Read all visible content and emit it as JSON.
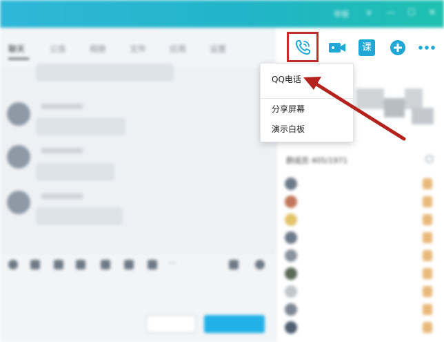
{
  "window": {
    "title": "",
    "report_label": "举报",
    "controls": {
      "dropdown": "∨",
      "minimize": "—",
      "maximize": "☐",
      "close": "✕"
    }
  },
  "tabs": [
    {
      "label": "聊天"
    },
    {
      "label": "公告"
    },
    {
      "label": "相册"
    },
    {
      "label": "文件"
    },
    {
      "label": "应用"
    },
    {
      "label": "设置"
    }
  ],
  "toolbar": {
    "icons": [
      "phone-icon",
      "video-icon",
      "course-icon",
      "add-icon",
      "more-icon"
    ],
    "course_label": "课"
  },
  "dropdown_menu": {
    "items": [
      {
        "label": "QQ电话"
      },
      {
        "label": "分享屏幕"
      },
      {
        "label": "演示白板"
      }
    ]
  },
  "chat": {
    "messages": [
      {
        "text": ""
      },
      {
        "text": ""
      },
      {
        "text": ""
      },
      {
        "text": ""
      }
    ]
  },
  "input": {
    "close_label": "",
    "send_label": ""
  },
  "members": {
    "header": "群成员 405/1971",
    "list": [
      {
        "name": ""
      },
      {
        "name": ""
      },
      {
        "name": ""
      },
      {
        "name": ""
      },
      {
        "name": ""
      },
      {
        "name": ""
      },
      {
        "name": ""
      },
      {
        "name": ""
      },
      {
        "name": ""
      }
    ]
  },
  "colors": {
    "titlebar": "#22b4c8",
    "accent": "#1fa8d6",
    "highlight_box": "#c0302a",
    "arrow": "#b3221c"
  }
}
